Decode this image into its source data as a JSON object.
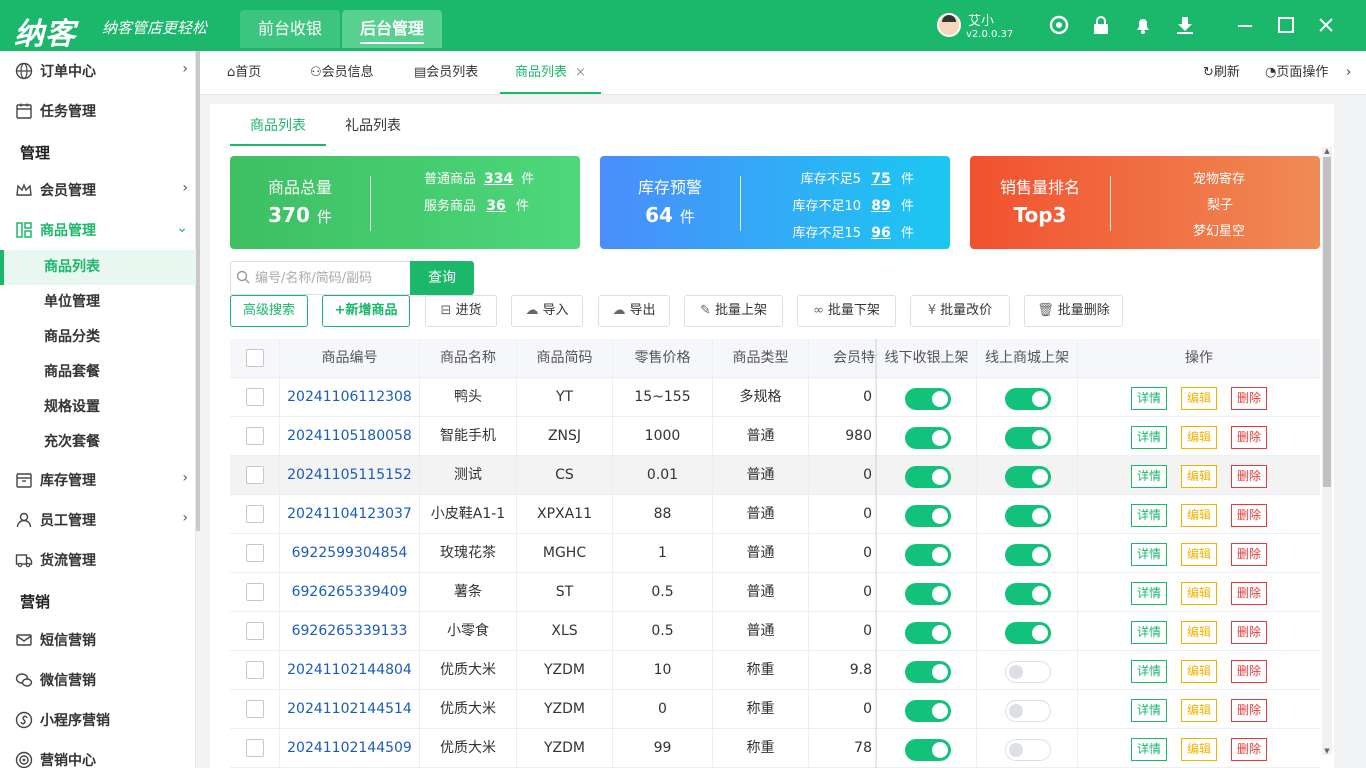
{
  "header": {
    "logo": "纳客",
    "slogan": "纳客管店更轻松",
    "tabs": [
      "前台收银",
      "后台管理"
    ],
    "user_name": "艾小",
    "version": "v2.0.0.37"
  },
  "sidebar": {
    "items": [
      {
        "label": "订单中心",
        "icon": "globe-icon"
      },
      {
        "label": "任务管理",
        "icon": "calendar-icon"
      },
      {
        "label": "管理"
      },
      {
        "label": "会员管理",
        "icon": "crown-icon"
      },
      {
        "label": "商品管理",
        "icon": "grid-icon"
      },
      {
        "label": "库存管理",
        "icon": "box-icon"
      },
      {
        "label": "员工管理",
        "icon": "user-icon"
      },
      {
        "label": "货流管理",
        "icon": "truck-icon"
      },
      {
        "label": "营销"
      },
      {
        "label": "短信营销",
        "icon": "mail-icon"
      },
      {
        "label": "微信营销",
        "icon": "wechat-icon"
      },
      {
        "label": "小程序营销",
        "icon": "miniapp-icon"
      },
      {
        "label": "营销中心",
        "icon": "target-icon"
      }
    ],
    "sub_items": [
      "商品列表",
      "单位管理",
      "商品分类",
      "商品套餐",
      "规格设置",
      "充次套餐"
    ]
  },
  "tabbar": {
    "tabs": [
      "首页",
      "会员信息",
      "会员列表",
      "商品列表"
    ],
    "close": "×",
    "refresh": "刷新",
    "page_ops": "页面操作"
  },
  "subtabs": [
    "商品列表",
    "礼品列表"
  ],
  "cards": {
    "total": {
      "title": "商品总量",
      "value": "370",
      "unit": "件",
      "lines": [
        {
          "label": "普通商品",
          "value": "334",
          "unit": "件"
        },
        {
          "label": "服务商品",
          "value": "36",
          "unit": "件"
        }
      ]
    },
    "stock": {
      "title": "库存预警",
      "value": "64",
      "unit": "件",
      "lines": [
        {
          "label": "库存不足5",
          "value": "75",
          "unit": "件"
        },
        {
          "label": "库存不足10",
          "value": "89",
          "unit": "件"
        },
        {
          "label": "库存不足15",
          "value": "96",
          "unit": "件"
        }
      ]
    },
    "sales": {
      "title": "销售量排名",
      "value": "Top3",
      "items": [
        "宠物寄存",
        "梨子",
        "梦幻星空"
      ]
    }
  },
  "search": {
    "placeholder": "编号/名称/简码/副码",
    "button": "查询"
  },
  "toolbar": [
    "高级搜索",
    "+新增商品",
    "进货",
    "导入",
    "导出",
    "批量上架",
    "批量下架",
    "批量改价",
    "批量删除"
  ],
  "table": {
    "headers": [
      "商品编号",
      "商品名称",
      "商品简码",
      "零售价格",
      "商品类型",
      "会员特价",
      "线下收银上架",
      "线上商城上架",
      "操作"
    ],
    "ops": [
      "详情",
      "编辑",
      "删除"
    ],
    "rows": [
      {
        "code": "20241106112308",
        "name": "鸭头",
        "short": "YT",
        "price": "15~155",
        "type": "多规格",
        "member": "0",
        "offline": true,
        "online": true
      },
      {
        "code": "20241105180058",
        "name": "智能手机",
        "short": "ZNSJ",
        "price": "1000",
        "type": "普通",
        "member": "980",
        "offline": true,
        "online": true
      },
      {
        "code": "20241105115152",
        "name": "测试",
        "short": "CS",
        "price": "0.01",
        "type": "普通",
        "member": "0",
        "offline": true,
        "online": true
      },
      {
        "code": "20241104123037",
        "name": "小皮鞋A1-1",
        "short": "XPXA11",
        "price": "88",
        "type": "普通",
        "member": "0",
        "offline": true,
        "online": true
      },
      {
        "code": "6922599304854",
        "name": "玫瑰花茶",
        "short": "MGHC",
        "price": "1",
        "type": "普通",
        "member": "0",
        "offline": true,
        "online": true
      },
      {
        "code": "6926265339409",
        "name": "薯条",
        "short": "ST",
        "price": "0.5",
        "type": "普通",
        "member": "0",
        "offline": true,
        "online": true
      },
      {
        "code": "6926265339133",
        "name": "小零食",
        "short": "XLS",
        "price": "0.5",
        "type": "普通",
        "member": "0",
        "offline": true,
        "online": true
      },
      {
        "code": "20241102144804",
        "name": "优质大米",
        "short": "YZDM",
        "price": "10",
        "type": "称重",
        "member": "9.8",
        "offline": true,
        "online": false
      },
      {
        "code": "20241102144514",
        "name": "优质大米",
        "short": "YZDM",
        "price": "0",
        "type": "称重",
        "member": "0",
        "offline": true,
        "online": false
      },
      {
        "code": "20241102144509",
        "name": "优质大米",
        "short": "YZDM",
        "price": "99",
        "type": "称重",
        "member": "78",
        "offline": true,
        "online": false
      }
    ]
  },
  "colors": {
    "brand": "#1bb76b",
    "link": "#1a5bbf",
    "edit": "#f0b400",
    "delete": "#e23c3c"
  }
}
